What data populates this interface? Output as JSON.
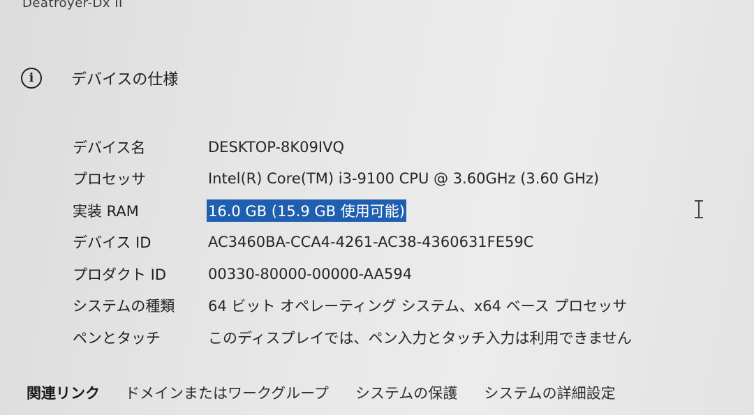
{
  "window": {
    "device_header": "Deatroyer-Dx II"
  },
  "section": {
    "title": "デバイスの仕様",
    "icon": "info-icon"
  },
  "specs": [
    {
      "label": "デバイス名",
      "value": "DESKTOP-8K09IVQ",
      "selected": false
    },
    {
      "label": "プロセッサ",
      "value": "Intel(R) Core(TM) i3-9100 CPU @ 3.60GHz (3.60 GHz)",
      "selected": false
    },
    {
      "label": "実装 RAM",
      "value": "16.0 GB (15.9 GB 使用可能)",
      "selected": true
    },
    {
      "label": "デバイス ID",
      "value": "AC3460BA-CCA4-4261-AC38-4360631FE59C",
      "selected": false
    },
    {
      "label": "プロダクト ID",
      "value": "00330-80000-00000-AA594",
      "selected": false
    },
    {
      "label": "システムの種類",
      "value": "64 ビット オペレーティング システム、x64 ベース プロセッサ",
      "selected": false
    },
    {
      "label": "ペンとタッチ",
      "value": "このディスプレイでは、ペン入力とタッチ入力は利用できません",
      "selected": false
    }
  ],
  "related": {
    "title": "関連リンク",
    "links": [
      "ドメインまたはワークグループ",
      "システムの保護",
      "システムの詳細設定"
    ]
  },
  "colors": {
    "selection": "#1f5fb0",
    "selection_text": "#ffffff"
  }
}
